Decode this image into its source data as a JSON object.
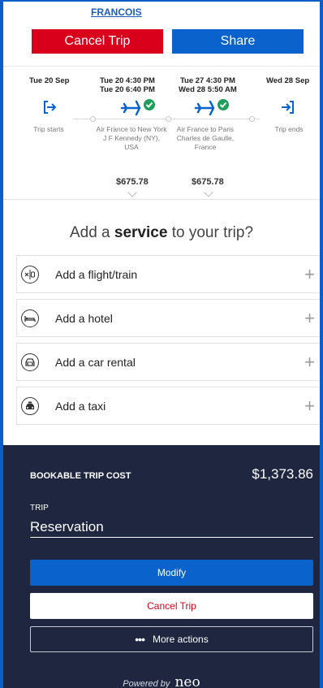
{
  "header": {
    "traveler_link": "FRANCOIS",
    "cancel_label": "Cancel Trip",
    "share_label": "Share"
  },
  "timeline": {
    "start": {
      "date": "Tue 20 Sep",
      "desc": "Trip starts"
    },
    "flight1": {
      "dep": "Tue 20  4:30 PM",
      "arr": "Tue 20  6:40 PM",
      "desc": "Air France to New York J F Kennedy (NY), USA",
      "price": "$675.78"
    },
    "flight2": {
      "dep": "Tue 27  4:30 PM",
      "arr": "Wed 28  5:50 AM",
      "desc": "Air France to Paris Charles de Gaulle, France",
      "price": "$675.78"
    },
    "end": {
      "date": "Wed 28 Sep",
      "desc": "Trip ends"
    }
  },
  "services": {
    "title_pre": "Add a ",
    "title_bold": "service",
    "title_post": " to your trip?",
    "items": [
      {
        "label": "Add a flight/train",
        "icon": "flight-train-icon"
      },
      {
        "label": "Add a hotel",
        "icon": "hotel-icon"
      },
      {
        "label": "Add a car rental",
        "icon": "car-rental-icon"
      },
      {
        "label": "Add a taxi",
        "icon": "taxi-icon"
      }
    ],
    "plus": "+"
  },
  "summary": {
    "cost_label": "BOOKABLE TRIP COST",
    "cost_value": "$1,373.86",
    "trip_label": "TRIP",
    "trip_value": "Reservation",
    "modify_label": "Modify",
    "cancel_label": "Cancel Trip",
    "more_label": "More actions",
    "powered_by": "Powered by",
    "brand": "neo"
  },
  "colors": {
    "cancel_red": "#d9001b",
    "share_blue": "#0a63cc",
    "dark_navy": "#1f2640",
    "check_green": "#1e9e5a"
  }
}
